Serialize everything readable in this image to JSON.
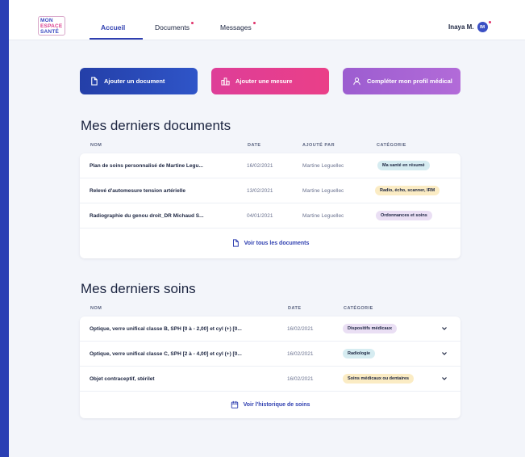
{
  "logo": {
    "line1": "MON",
    "line2": "ESPACE",
    "line3": "SANTÉ"
  },
  "nav": {
    "tabs": [
      {
        "label": "Accueil"
      },
      {
        "label": "Documents"
      },
      {
        "label": "Messages"
      }
    ],
    "user": {
      "name": "Inaya M.",
      "initials": "IM"
    }
  },
  "actions": [
    {
      "label": "Ajouter un document",
      "icon": "document-icon"
    },
    {
      "label": "Ajouter une mesure",
      "icon": "measure-icon"
    },
    {
      "label": "Compléter mon profil médical",
      "icon": "user-icon"
    }
  ],
  "documents": {
    "title": "Mes derniers documents",
    "columns": [
      "NOM",
      "DATE",
      "AJOUTÉ PAR",
      "CATÉGORIE"
    ],
    "rows": [
      {
        "name": "Plan de soins personnalisé de Martine Legu...",
        "date": "16/02/2021",
        "added_by": "Martine Leguellec",
        "category": "Ma santé en résumé",
        "category_color": "#d6ecf1"
      },
      {
        "name": "Relevé d'automesure tension artérielle",
        "date": "13/02/2021",
        "added_by": "Martine Leguellec",
        "category": "Radio, écho, scanner, IRM",
        "category_color": "#fbecc4"
      },
      {
        "name": "Radiographie du genou droit_DR Michaud S...",
        "date": "04/01/2021",
        "added_by": "Martine Leguellec",
        "category": "Ordonnances et soins",
        "category_color": "#eadff4"
      }
    ],
    "footer_link": "Voir tous les documents"
  },
  "soins": {
    "title": "Mes derniers soins",
    "columns": [
      "NOM",
      "DATE",
      "CATÉGORIE"
    ],
    "rows": [
      {
        "name": "Optique, verre unifical classe B, SPH [0 à - 2,00] et cyl (+) [0...",
        "date": "16/02/2021",
        "category": "Dispositifs médicaux",
        "category_color": "#eadff4"
      },
      {
        "name": "Optique, verre unifical classe C, SPH [2 à - 4,00] et cyl (+) [0...",
        "date": "16/02/2021",
        "category": "Radiologie",
        "category_color": "#d6ecf1"
      },
      {
        "name": "Objet contraceptif, stérilet",
        "date": "16/02/2021",
        "category": "Soins médicaux ou dentaires",
        "category_color": "#fbecc4"
      }
    ],
    "footer_link": "Voir l'historique de soins"
  },
  "colors": {
    "primary": "#2f3fb0",
    "pink": "#e23c93",
    "purple": "#a765d4",
    "notification": "#e0336b"
  }
}
